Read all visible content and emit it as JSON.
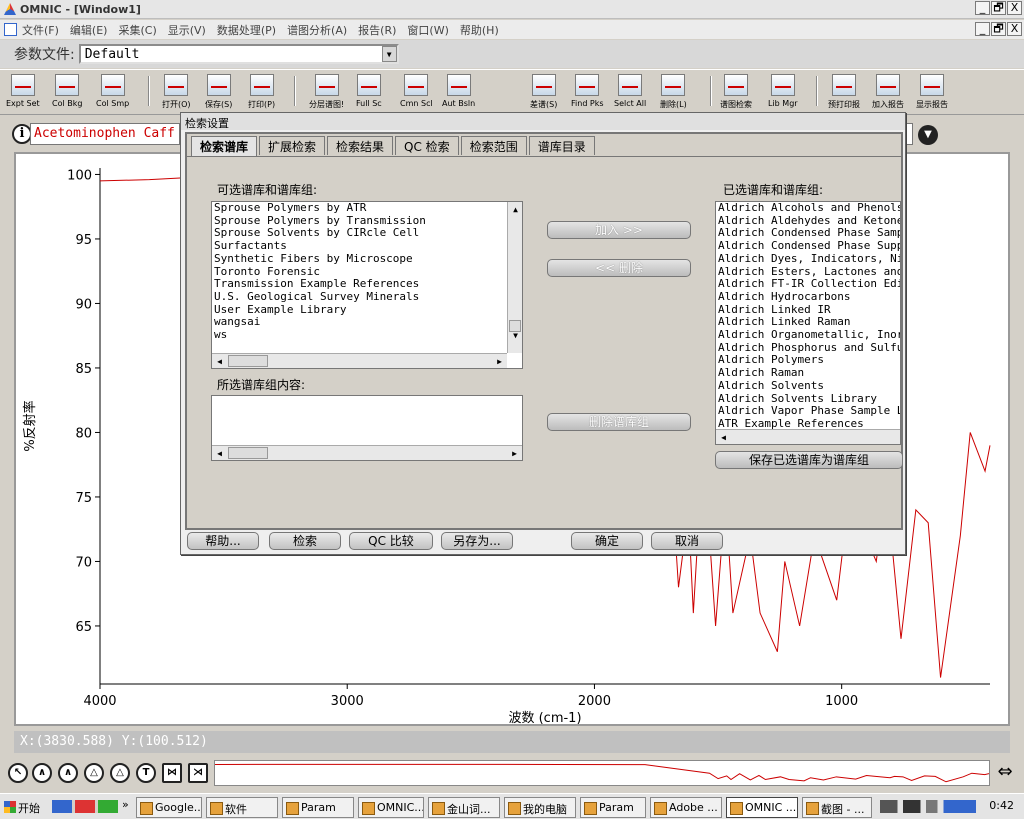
{
  "window": {
    "title": "OMNIC - [Window1]",
    "controls": [
      "_",
      "🗗",
      "X"
    ]
  },
  "menu": [
    "文件(F)",
    "编辑(E)",
    "采集(C)",
    "显示(V)",
    "数据处理(P)",
    "谱图分析(A)",
    "报告(R)",
    "窗口(W)",
    "帮助(H)"
  ],
  "param": {
    "label": "参数文件:",
    "value": "Default"
  },
  "toolbar": [
    "Expt Set",
    "Col Bkg",
    "Col Smp",
    "打开(O)",
    "保存(S)",
    "打印(P)",
    "分层谱图!",
    "Full Sc",
    "Cmn Scl",
    "Aut Bsln",
    "差谱(S)",
    "Find Pks",
    "Selct All",
    "删除(L)",
    "谱图检索",
    "Lib Mgr",
    "预打印报",
    "加入报告",
    "显示报告"
  ],
  "spectrum_title": "Acetominophen Caff",
  "coordinate_readout": "X:(3830.588) Y:(100.512)",
  "chart_data": {
    "type": "line",
    "xlabel": "波数 (cm-1)",
    "ylabel": "%反射率",
    "xlim": [
      4000,
      400
    ],
    "ylim": [
      60.5,
      100.5
    ],
    "xticks": [
      "4000",
      "3000",
      "2000",
      "1000"
    ],
    "yticks": [
      "100",
      "95",
      "90",
      "85",
      "80",
      "75",
      "70",
      "65"
    ],
    "x": [
      4000,
      3800,
      3600,
      3200,
      2400,
      2000,
      1700,
      1660,
      1620,
      1600,
      1560,
      1510,
      1470,
      1440,
      1370,
      1330,
      1260,
      1230,
      1170,
      1110,
      1020,
      970,
      860,
      840,
      800,
      760,
      700,
      650,
      600,
      520,
      480,
      420,
      400
    ],
    "y": [
      99.5,
      99.6,
      99.8,
      99.7,
      99.5,
      99.2,
      80,
      68,
      74,
      66,
      79,
      65,
      75,
      66,
      72,
      66,
      63,
      70,
      65,
      72,
      67,
      75,
      70,
      73,
      72,
      64,
      74,
      73,
      61,
      72,
      80,
      77,
      79
    ],
    "color": "#cc0000"
  },
  "bottom_tool_icons": [
    "select-tool-icon",
    "region-tool-icon",
    "peak-height-tool-icon",
    "peak-area-tool-icon",
    "label-tool-icon",
    "text-tool-icon",
    "fit-icon-1",
    "fit-icon-2"
  ],
  "dialog": {
    "title": "检索设置",
    "tabs": [
      "检索谱库",
      "扩展检索",
      "检索结果",
      "QC 检索",
      "检索范围",
      "谱库目录"
    ],
    "available_label": "可选谱库和谱库组:",
    "available_items": [
      "Sprouse Polymers by ATR",
      "Sprouse Polymers by Transmission",
      "Sprouse Solvents by CIRcle Cell",
      "Surfactants",
      "Synthetic Fibers by Microscope",
      "Toronto Forensic",
      "Transmission Example References",
      "U.S. Geological Survey Minerals",
      "User Example Library",
      "wangsai",
      "ws"
    ],
    "selected_label": "已选谱库和谱库组:",
    "selected_items": [
      "Aldrich Alcohols and Phenols",
      "Aldrich Aldehydes and Ketones",
      "Aldrich Condensed Phase Sampl",
      "Aldrich Condensed Phase Suppl",
      "Aldrich Dyes, Indicators, Nit",
      "Aldrich Esters, Lactones and",
      "Aldrich FT-IR Collection Edit",
      "Aldrich Hydrocarbons",
      "Aldrich Linked IR",
      "Aldrich Linked Raman",
      "Aldrich Organometallic, Inorg",
      "Aldrich Phosphorus and Sulfur",
      "Aldrich Polymers",
      "Aldrich Raman",
      "Aldrich Solvents",
      "Aldrich Solvents Library",
      "Aldrich Vapor Phase Sample Li",
      "ATR Example References"
    ],
    "group_content_label": "所选谱库组内容:",
    "add_button": "加入 >>",
    "remove_button": "<< 删除",
    "delete_group_button": "删除谱库组",
    "save_group_button": "保存已选谱库为谱库组",
    "footer": [
      "帮助...",
      "检索",
      "QC 比较",
      "另存为...",
      "确定",
      "取消"
    ]
  },
  "taskbar": {
    "start": "开始",
    "items": [
      "Google...",
      "软件",
      "Param",
      "OMNIC...",
      "金山词...",
      "我的电脑",
      "Param",
      "Adobe ...",
      "OMNIC ...",
      "截图 - ..."
    ],
    "clock": "0:42"
  }
}
